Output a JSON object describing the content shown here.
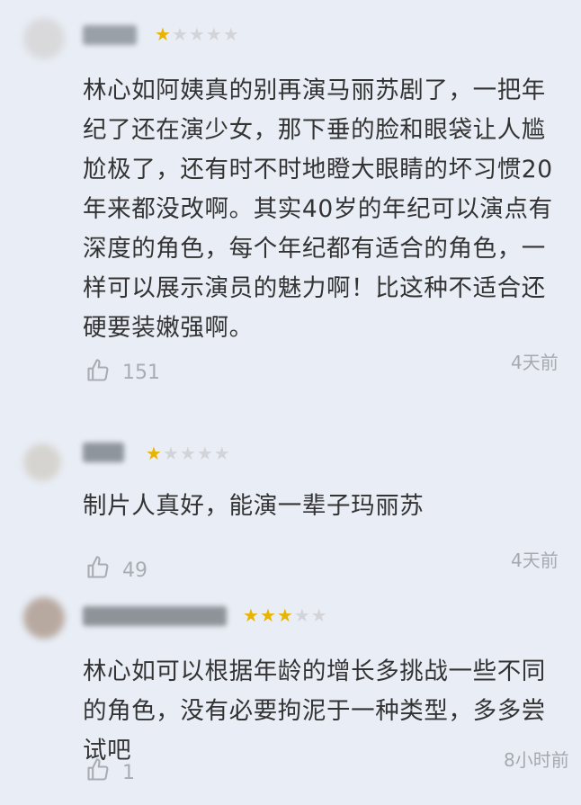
{
  "reviews": [
    {
      "rating": 1,
      "max_rating": 5,
      "text": "林心如阿姨真的别再演马丽苏剧了，一把年纪了还在演少女，那下垂的脸和眼袋让人尴尬极了，还有时不时地瞪大眼睛的坏习惯20年来都没改啊。其实40岁的年纪可以演点有深度的角色，每个年纪都有适合的角色，一样可以展示演员的魅力啊！比这种不适合还硬要装嫩强啊。",
      "likes": "151",
      "time": "4天前"
    },
    {
      "rating": 1,
      "max_rating": 5,
      "text": "制片人真好，能演一辈子玛丽苏",
      "likes": "49",
      "time": "4天前"
    },
    {
      "rating": 3,
      "max_rating": 5,
      "text": "林心如可以根据年龄的增长多挑战一些不同的角色，没有必要拘泥于一种类型，多多尝试吧",
      "likes": "1",
      "time": "8小时前"
    }
  ],
  "icons": {
    "like": "thumbs-up-icon",
    "star": "star-icon"
  },
  "colors": {
    "background": "#e9eef6",
    "star_active": "#e8b400",
    "star_inactive": "#d2d4d9",
    "text": "#333333",
    "meta": "#a9adb3"
  }
}
